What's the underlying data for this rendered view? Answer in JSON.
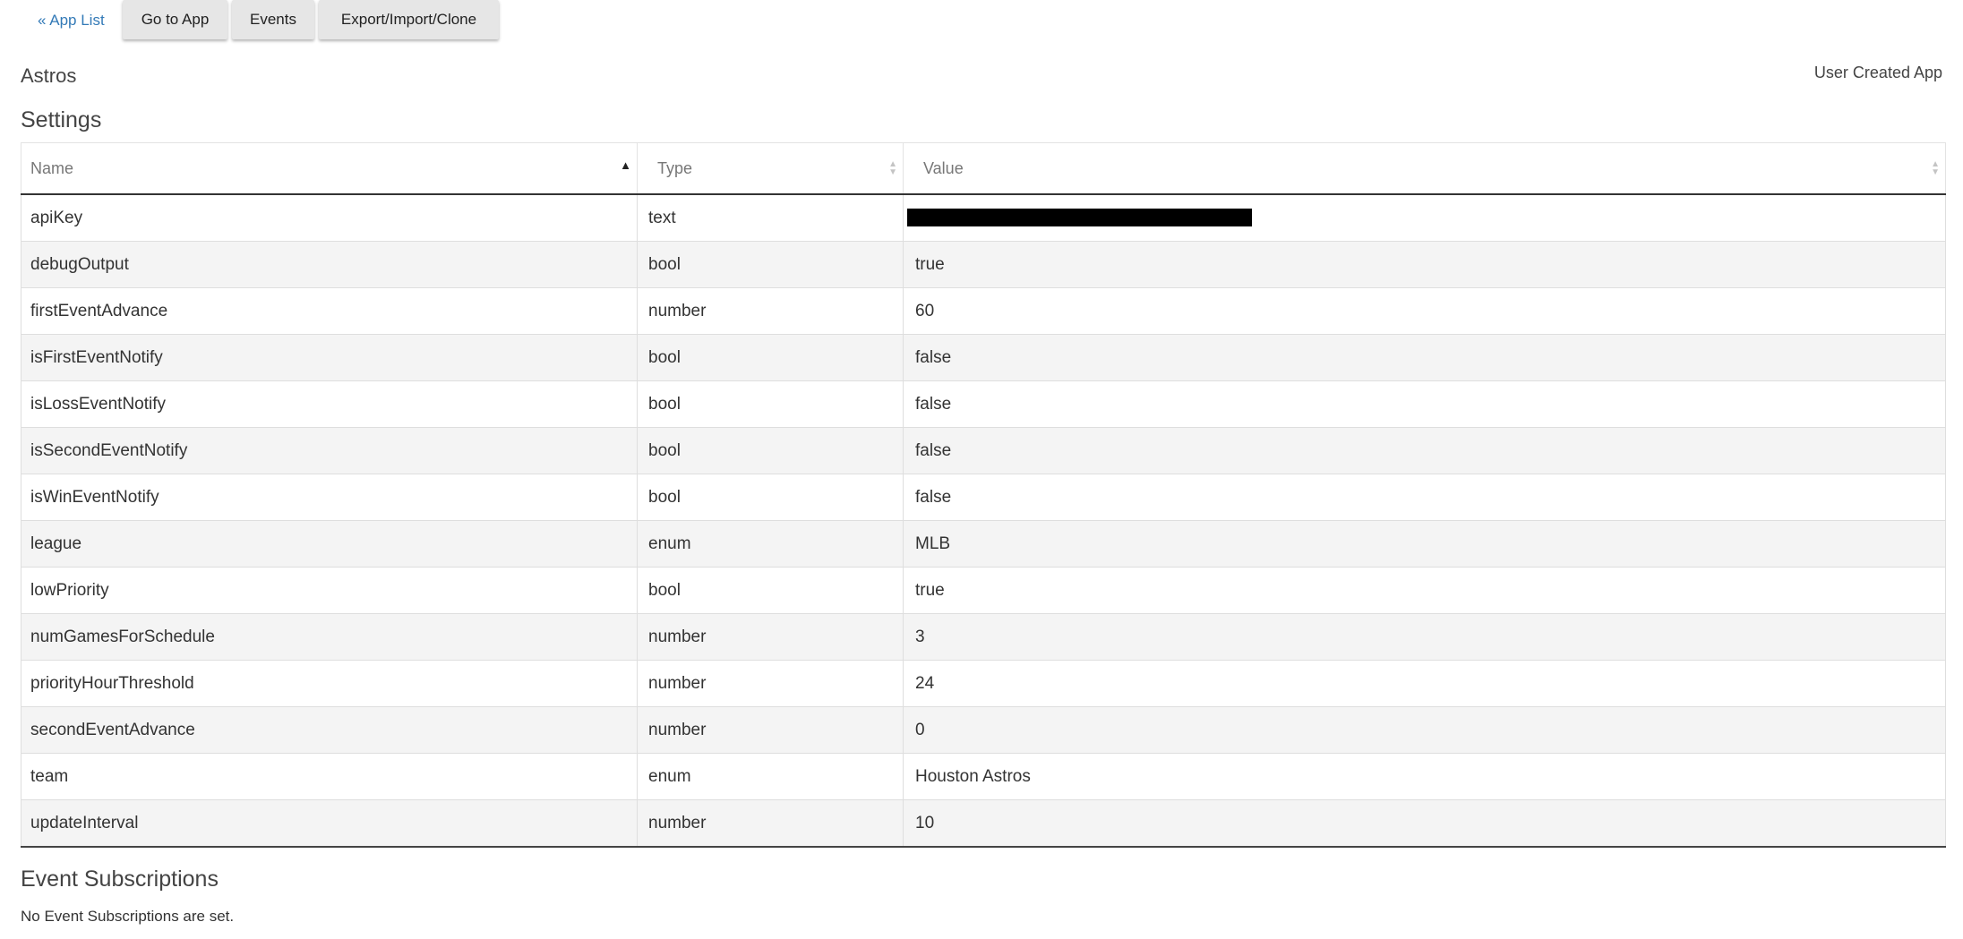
{
  "nav": {
    "app_list_label": "« App List",
    "go_to_app_label": "Go to App",
    "events_label": "Events",
    "export_label": "Export/Import/Clone"
  },
  "app": {
    "name": "Astros",
    "type_label": "User Created App"
  },
  "settings": {
    "heading": "Settings",
    "columns": {
      "name": "Name",
      "type": "Type",
      "value": "Value"
    },
    "sort": {
      "column": "name",
      "direction": "ascending"
    },
    "rows": [
      {
        "name": "apiKey",
        "type": "text",
        "value": "",
        "redacted": true
      },
      {
        "name": "debugOutput",
        "type": "bool",
        "value": "true"
      },
      {
        "name": "firstEventAdvance",
        "type": "number",
        "value": "60"
      },
      {
        "name": "isFirstEventNotify",
        "type": "bool",
        "value": "false"
      },
      {
        "name": "isLossEventNotify",
        "type": "bool",
        "value": "false"
      },
      {
        "name": "isSecondEventNotify",
        "type": "bool",
        "value": "false"
      },
      {
        "name": "isWinEventNotify",
        "type": "bool",
        "value": "false"
      },
      {
        "name": "league",
        "type": "enum",
        "value": "MLB"
      },
      {
        "name": "lowPriority",
        "type": "bool",
        "value": "true"
      },
      {
        "name": "numGamesForSchedule",
        "type": "number",
        "value": "3"
      },
      {
        "name": "priorityHourThreshold",
        "type": "number",
        "value": "24"
      },
      {
        "name": "secondEventAdvance",
        "type": "number",
        "value": "0"
      },
      {
        "name": "team",
        "type": "enum",
        "value": "Houston Astros"
      },
      {
        "name": "updateInterval",
        "type": "number",
        "value": "10"
      }
    ]
  },
  "events": {
    "heading": "Event Subscriptions",
    "empty_message": "No Event Subscriptions are set."
  },
  "colors": {
    "link": "#337ab7",
    "button_bg": "#e6e6e6",
    "row_stripe": "#f4f4f4",
    "redaction": "#000000"
  },
  "icons": {
    "sort_ascending": "triangle-up",
    "sort_both": "double-triangle"
  }
}
